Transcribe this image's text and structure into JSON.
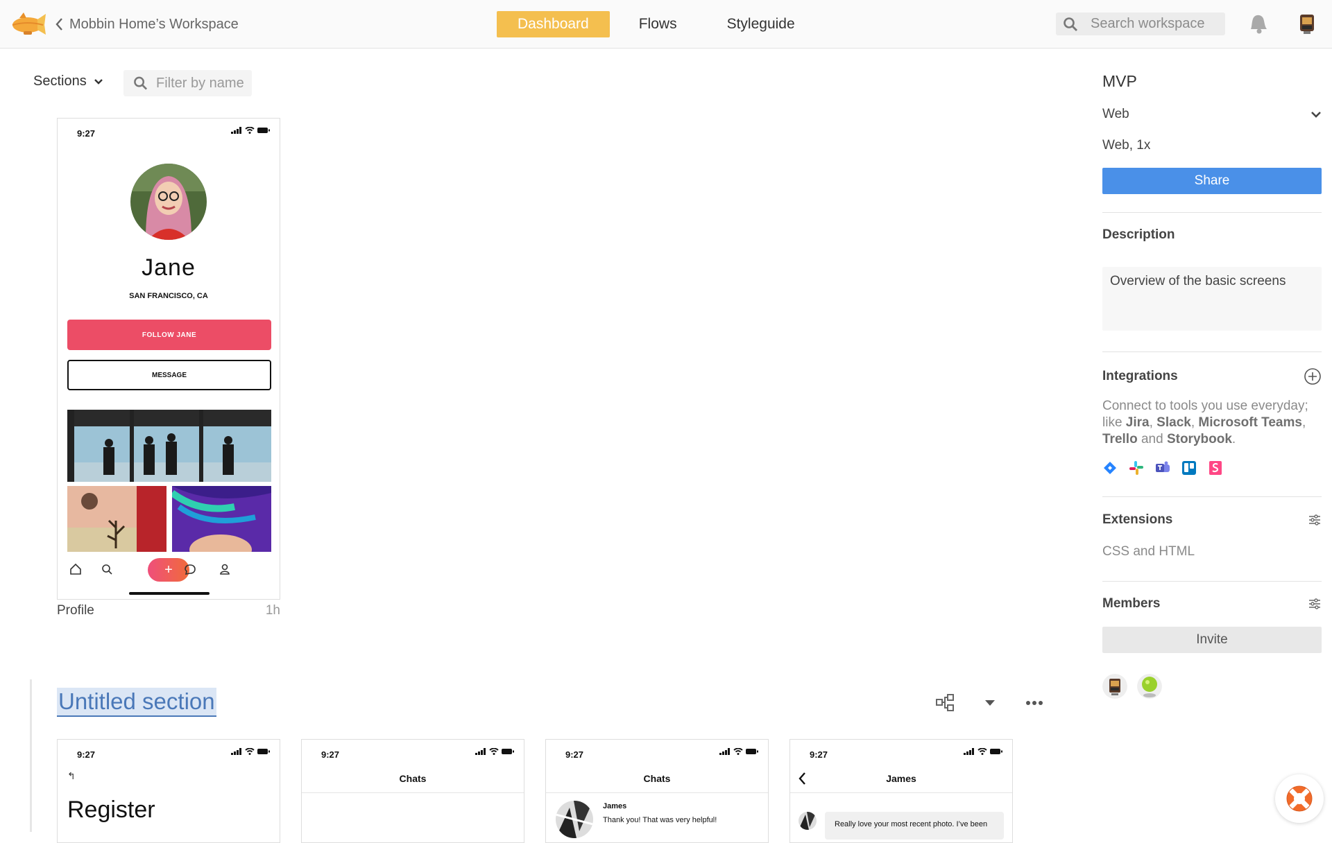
{
  "header": {
    "back_label": "Mobbin Home’s Workspace",
    "nav": [
      {
        "label": "Dashboard",
        "active": true
      },
      {
        "label": "Flows",
        "active": false
      },
      {
        "label": "Styleguide",
        "active": false
      }
    ],
    "search_placeholder": "Search workspace",
    "accent_color": "#f4bf4f"
  },
  "toolbar": {
    "sections_label": "Sections",
    "filter_placeholder": "Filter by name"
  },
  "profile_screen": {
    "time": "9:27",
    "name": "Jane",
    "location": "SAN FRANCISCO, CA",
    "follow_label": "FOLLOW JANE",
    "message_label": "MESSAGE",
    "plus_label": "+",
    "caption": "Profile",
    "caption_time": "1h"
  },
  "section": {
    "title": "Untitled section",
    "screens": [
      {
        "time": "9:27",
        "back": "↰",
        "title": "Register"
      },
      {
        "time": "9:27",
        "title": "Chats"
      },
      {
        "time": "9:27",
        "title": "Chats",
        "chat_name": "James",
        "chat_message": "Thank you! That was very helpful!"
      },
      {
        "time": "9:27",
        "title": "James",
        "bubble": "Really love your most recent photo. I’ve been"
      }
    ]
  },
  "right_panel": {
    "title": "MVP",
    "platform": "Web",
    "density": "Web, 1x",
    "share_label": "Share",
    "description_heading": "Description",
    "description_text": "Overview of the basic screens",
    "integrations_heading": "Integrations",
    "integrations_text_1": "Connect to tools you use everyday; like ",
    "integrations_tools": [
      "Jira",
      "Slack",
      "Microsoft Teams",
      "Trello",
      "Storybook"
    ],
    "integrations_sep_1": ", ",
    "integrations_sep_2": " and ",
    "integrations_end": ".",
    "extensions_heading": "Extensions",
    "extensions_text": "CSS and HTML",
    "members_heading": "Members",
    "invite_label": "Invite",
    "share_color": "#4a90e8"
  }
}
